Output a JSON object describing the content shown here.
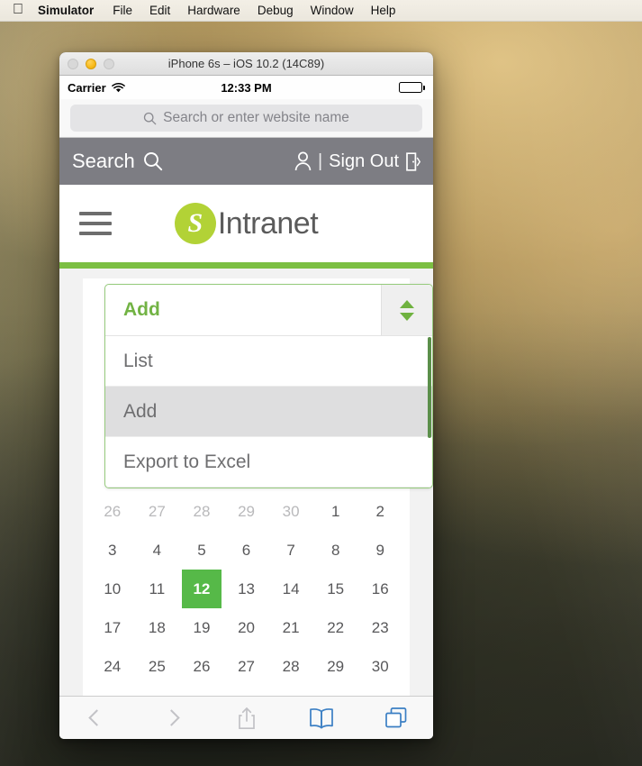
{
  "menubar": {
    "apple_icon": "apple-logo-icon",
    "items": [
      {
        "label": "Simulator",
        "bold": true
      },
      {
        "label": "File",
        "bold": false
      },
      {
        "label": "Edit",
        "bold": false
      },
      {
        "label": "Hardware",
        "bold": false
      },
      {
        "label": "Debug",
        "bold": false
      },
      {
        "label": "Window",
        "bold": false
      },
      {
        "label": "Help",
        "bold": false
      }
    ]
  },
  "window": {
    "title": "iPhone 6s – iOS 10.2 (14C89)",
    "traffic_lights": {
      "close": "close-button",
      "minimize": "minimize-button",
      "zoom": "zoom-button"
    }
  },
  "status_bar": {
    "carrier": "Carrier",
    "wifi_icon": "wifi-icon",
    "time": "12:33 PM",
    "battery_icon": "battery-full-icon"
  },
  "safari": {
    "url_placeholder": "Search or enter website name",
    "url_value": "",
    "search_icon": "search-icon",
    "toolbar": {
      "back": "back-chevron-icon",
      "forward": "forward-chevron-icon",
      "share": "share-icon",
      "bookmarks": "bookmarks-book-icon",
      "tabs": "tabs-icon"
    }
  },
  "page": {
    "header": {
      "search_label": "Search",
      "search_icon": "search-icon",
      "user_icon": "user-person-icon",
      "separator": "|",
      "signout_label": "Sign Out",
      "signout_icon": "exit-door-icon",
      "background_color": "#7d7d83"
    },
    "branding": {
      "menu_icon": "hamburger-menu-icon",
      "logo_letter": "S",
      "logo_color": "#b2d236",
      "brand_name": "Intranet"
    },
    "accent_bar_color": "#7cbf42"
  },
  "dropdown": {
    "selected_label": "Add",
    "selected_color": "#72b344",
    "stepper_up_icon": "stepper-up-arrow-icon",
    "stepper_down_icon": "stepper-down-arrow-icon",
    "options": [
      {
        "label": "List",
        "active": false
      },
      {
        "label": "Add",
        "active": true
      },
      {
        "label": "Export to Excel",
        "active": false
      }
    ]
  },
  "calendar": {
    "selected_day": "12",
    "selected_color": "#56b948",
    "weeks": [
      [
        {
          "d": "26",
          "muted": true
        },
        {
          "d": "27",
          "muted": true
        },
        {
          "d": "28",
          "muted": true
        },
        {
          "d": "29",
          "muted": true
        },
        {
          "d": "30",
          "muted": true
        },
        {
          "d": "1",
          "muted": false
        },
        {
          "d": "2",
          "muted": false
        }
      ],
      [
        {
          "d": "3",
          "muted": false
        },
        {
          "d": "4",
          "muted": false
        },
        {
          "d": "5",
          "muted": false
        },
        {
          "d": "6",
          "muted": false
        },
        {
          "d": "7",
          "muted": false
        },
        {
          "d": "8",
          "muted": false
        },
        {
          "d": "9",
          "muted": false
        }
      ],
      [
        {
          "d": "10",
          "muted": false
        },
        {
          "d": "11",
          "muted": false
        },
        {
          "d": "12",
          "muted": false,
          "selected": true
        },
        {
          "d": "13",
          "muted": false
        },
        {
          "d": "14",
          "muted": false
        },
        {
          "d": "15",
          "muted": false
        },
        {
          "d": "16",
          "muted": false
        }
      ],
      [
        {
          "d": "17",
          "muted": false
        },
        {
          "d": "18",
          "muted": false
        },
        {
          "d": "19",
          "muted": false
        },
        {
          "d": "20",
          "muted": false
        },
        {
          "d": "21",
          "muted": false
        },
        {
          "d": "22",
          "muted": false
        },
        {
          "d": "23",
          "muted": false
        }
      ],
      [
        {
          "d": "24",
          "muted": false
        },
        {
          "d": "25",
          "muted": false
        },
        {
          "d": "26",
          "muted": false
        },
        {
          "d": "27",
          "muted": false
        },
        {
          "d": "28",
          "muted": false
        },
        {
          "d": "29",
          "muted": false
        },
        {
          "d": "30",
          "muted": false
        }
      ]
    ]
  }
}
